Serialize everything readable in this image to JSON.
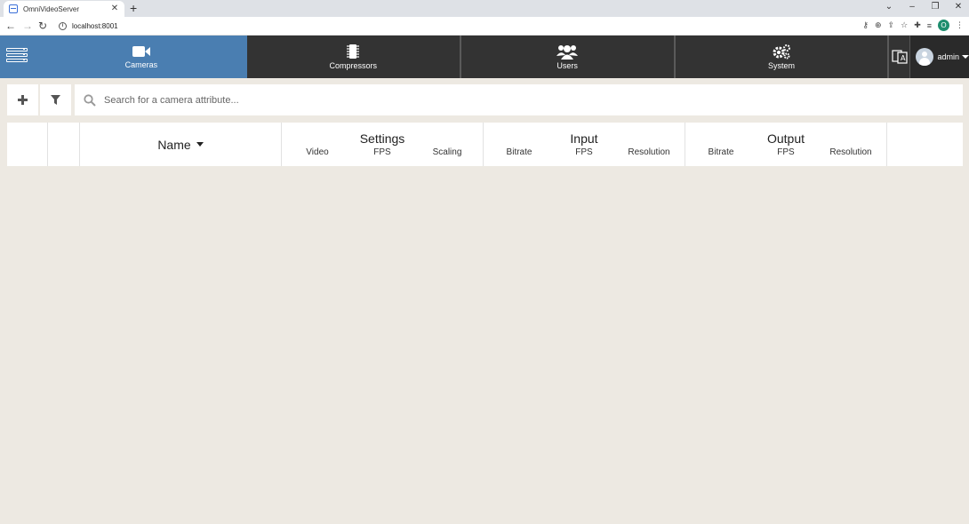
{
  "browser": {
    "tab_title": "OmniVideoServer",
    "url": "localhost:8001",
    "profile_initial": "O"
  },
  "nav": {
    "items": [
      {
        "label": "Cameras",
        "icon": "video-camera-icon",
        "active": true
      },
      {
        "label": "Compressors",
        "icon": "chip-icon",
        "active": false
      },
      {
        "label": "Users",
        "icon": "users-icon",
        "active": false
      },
      {
        "label": "System",
        "icon": "gears-icon",
        "active": false
      }
    ],
    "user": "admin"
  },
  "toolbar": {
    "search_placeholder": "Search for a camera attribute..."
  },
  "table": {
    "name_header": "Name",
    "groups": [
      {
        "title": "Settings",
        "columns": [
          "Video",
          "FPS",
          "Scaling"
        ]
      },
      {
        "title": "Input",
        "columns": [
          "Bitrate",
          "FPS",
          "Resolution"
        ]
      },
      {
        "title": "Output",
        "columns": [
          "Bitrate",
          "FPS",
          "Resolution"
        ]
      }
    ]
  },
  "colors": {
    "active_nav": "#4a7eb1",
    "nav_bg": "#333333",
    "page_bg": "#ede9e2"
  }
}
